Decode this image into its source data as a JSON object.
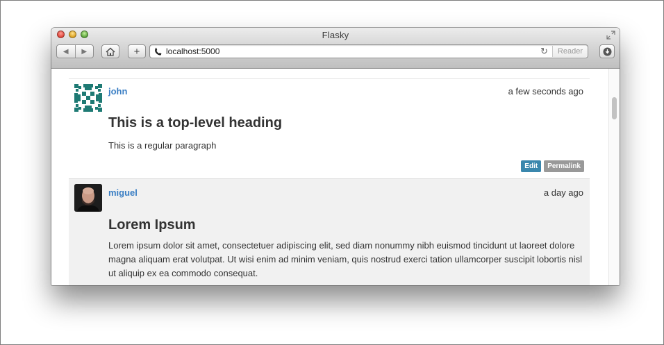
{
  "window": {
    "title": "Flasky",
    "url": "localhost:5000",
    "reader_label": "Reader"
  },
  "icons": {
    "back": "back-arrow-icon",
    "forward": "forward-arrow-icon",
    "home": "home-icon",
    "add": "plus-icon",
    "url": "phone-icon",
    "reload": "reload-icon",
    "download": "download-icon",
    "fullscreen": "fullscreen-icon"
  },
  "colors": {
    "link": "#3b7fc4",
    "edit_label": "#3a87ad",
    "permalink_label": "#999999"
  },
  "posts": [
    {
      "author": "john",
      "date": "a few seconds ago",
      "title": "This is a top-level heading",
      "body": "This is a regular paragraph",
      "actions": {
        "edit": "Edit",
        "permalink": "Permalink"
      }
    },
    {
      "author": "miguel",
      "date": "a day ago",
      "title": "Lorem Ipsum",
      "body": "Lorem ipsum dolor sit amet, consectetuer adipiscing elit, sed diam nonummy nibh euismod tincidunt ut laoreet dolore magna aliquam erat volutpat. Ut wisi enim ad minim veniam, quis nostrud exerci tation ullamcorper suscipit lobortis nisl ut aliquip ex ea commodo consequat."
    }
  ]
}
